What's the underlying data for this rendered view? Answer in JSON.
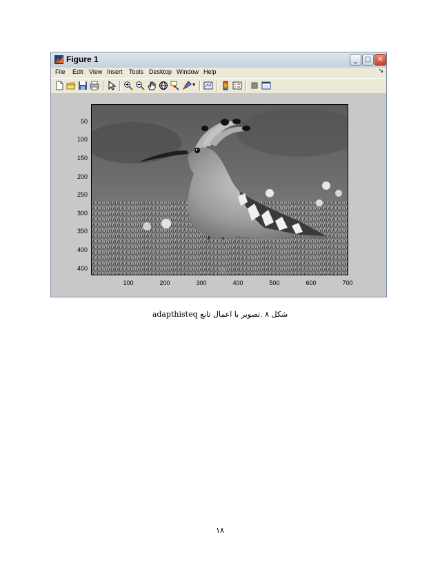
{
  "window": {
    "title": "Figure 1",
    "minimize_glyph": "_",
    "maximize_glyph": "□",
    "close_glyph": "✕"
  },
  "menu": {
    "items": [
      "File",
      "Edit",
      "View",
      "Insert",
      "Tools",
      "Desktop",
      "Window",
      "Help"
    ],
    "dock_arrow": "↘"
  },
  "toolbar": {
    "icons": [
      "new-figure-icon",
      "open-file-icon",
      "save-icon",
      "print-icon",
      "edit-plot-arrow-icon",
      "zoom-in-icon",
      "zoom-out-icon",
      "pan-hand-icon",
      "rotate-3d-icon",
      "data-cursor-icon",
      "brush-icon",
      "link-plot-icon",
      "colorbar-icon",
      "legend-icon",
      "hide-plot-tools-icon",
      "show-plot-tools-icon"
    ]
  },
  "axes": {
    "y_ticks": [
      "50",
      "100",
      "150",
      "200",
      "250",
      "300",
      "350",
      "400",
      "450"
    ],
    "x_ticks": [
      "100",
      "200",
      "300",
      "400",
      "500",
      "600",
      "700"
    ]
  },
  "image": {
    "subject": "hoopoe bird on grass",
    "colormap": "grayscale"
  },
  "caption": "شکل ۸ .تصویر با اعمال تابع adapthisteq",
  "page_number": "۱۸"
}
